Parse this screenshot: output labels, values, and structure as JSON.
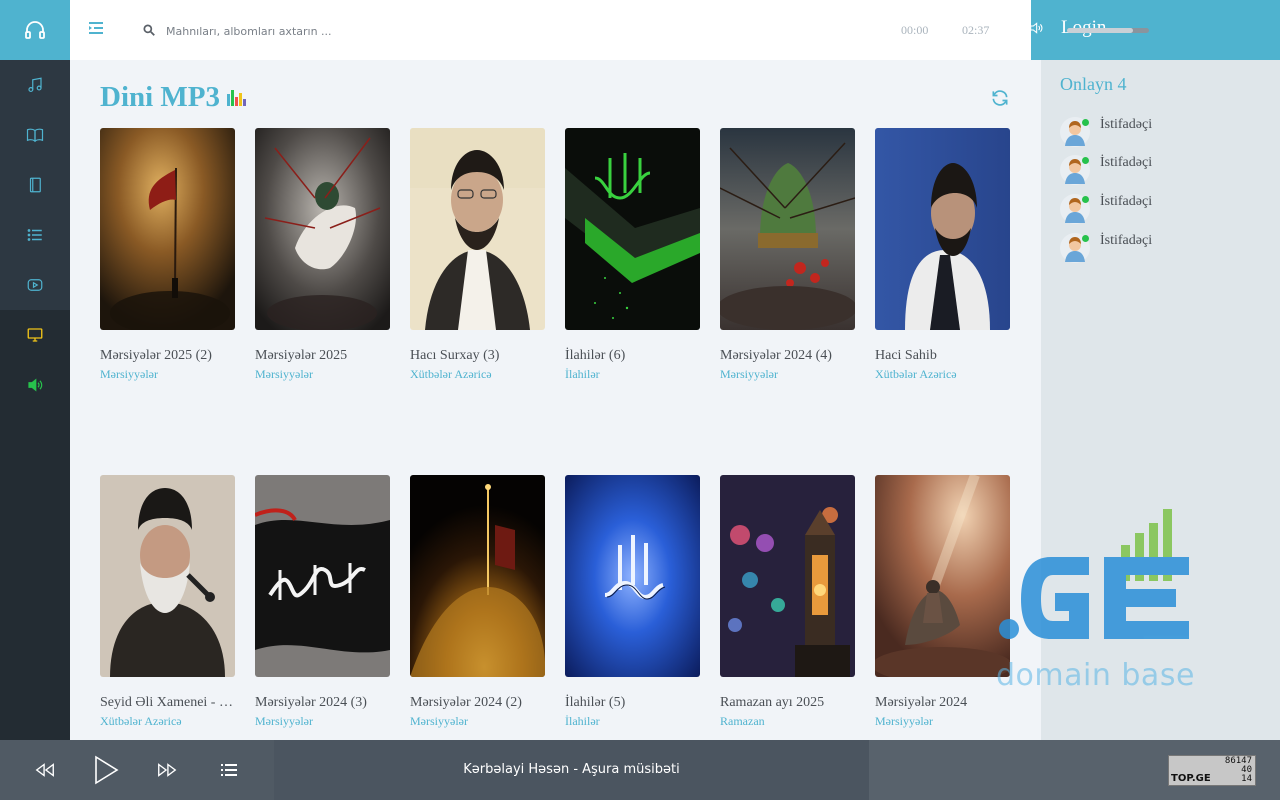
{
  "header": {
    "search_placeholder": "Mahnıları, albomları axtarın ..."
  },
  "sidebar": {
    "items": [
      {
        "icon": "music-note-icon"
      },
      {
        "icon": "book-icon"
      },
      {
        "icon": "notebook-icon"
      },
      {
        "icon": "list-icon"
      },
      {
        "icon": "video-play-icon"
      },
      {
        "icon": "monitor-icon"
      },
      {
        "icon": "speaker-icon"
      }
    ]
  },
  "main": {
    "title": "Dini MP3",
    "albums": [
      {
        "title": "Mərsiyələr 2025 (2)",
        "category": "Mərsiyyələr"
      },
      {
        "title": "Mərsiyələr 2025",
        "category": "Mərsiyyələr"
      },
      {
        "title": "Hacı Surxay (3)",
        "category": "Xütbələr Azəricə"
      },
      {
        "title": "İlahilər (6)",
        "category": "İlahilər"
      },
      {
        "title": "Mərsiyələr 2024 (4)",
        "category": "Mərsiyyələr"
      },
      {
        "title": "Haci Sahib",
        "category": "Xütbələr Azəricə"
      },
      {
        "title": "Seyid Əli Xamenei - Xütbələr",
        "category": "Xütbələr Azəricə"
      },
      {
        "title": "Mərsiyələr 2024 (3)",
        "category": "Mərsiyyələr"
      },
      {
        "title": "Mərsiyələr 2024 (2)",
        "category": "Mərsiyyələr"
      },
      {
        "title": "İlahilər (5)",
        "category": "İlahilər"
      },
      {
        "title": "Ramazan ayı 2025",
        "category": "Ramazan"
      },
      {
        "title": "Mərsiyələr 2024",
        "category": "Mərsiyyələr"
      }
    ]
  },
  "right_panel": {
    "login_label": "Login",
    "online_title": "Onlayn 4",
    "users": [
      "İstifadəçi",
      "İstifadəçi",
      "İstifadəçi",
      "İstifadəçi"
    ]
  },
  "watermark": {
    "brand": ".GE",
    "text": "domain base"
  },
  "player": {
    "now_playing": "Kərbəlayi Həsən - Aşura müsibəti",
    "current_time": "00:00",
    "total_time": "02:37",
    "volume": 0.8
  },
  "counter": {
    "brand": "TOP.GE",
    "values": [
      "86147",
      "40",
      "14"
    ]
  },
  "colors": {
    "accent": "#4fb3cf",
    "rail": "#232c33",
    "player": "#58626c"
  }
}
